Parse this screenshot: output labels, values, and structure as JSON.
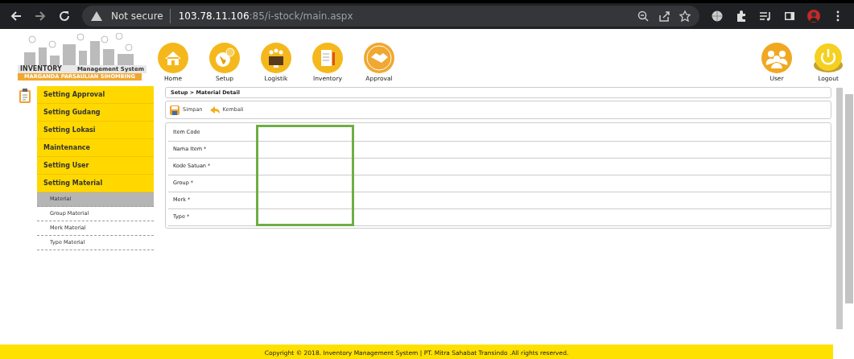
{
  "browser": {
    "security": "Not secure",
    "url_host": "103.78.11.106",
    "url_rest": ":85/i-stock/main.aspx"
  },
  "logo": {
    "title": "INVENTORY",
    "subtitle": "Management System",
    "owner": "MARGANDA PARSAULIAN SIHOMBING"
  },
  "nav": [
    {
      "label": "Home",
      "kind": "home"
    },
    {
      "label": "Setup",
      "kind": "setup"
    },
    {
      "label": "Logistik",
      "kind": "logistik"
    },
    {
      "label": "Inventory",
      "kind": "inventory"
    },
    {
      "label": "Approval",
      "kind": "approval"
    }
  ],
  "nav_right": [
    {
      "label": "User",
      "kind": "user"
    },
    {
      "label": "Logout",
      "kind": "logout"
    }
  ],
  "sidebar": {
    "items": [
      {
        "label": "Setting Approval"
      },
      {
        "label": "Setting Gudang"
      },
      {
        "label": "Setting Lokasi"
      },
      {
        "label": "Maintenance"
      },
      {
        "label": "Setting User"
      },
      {
        "label": "Setting Material",
        "children": [
          {
            "label": "Material",
            "selected": true
          },
          {
            "label": "Group Material",
            "selected": false
          },
          {
            "label": "Merk Material",
            "selected": false
          },
          {
            "label": "Type Material",
            "selected": false
          }
        ]
      }
    ]
  },
  "breadcrumb": "Setup > Material Detail",
  "toolbar": [
    {
      "label": "Simpan",
      "kind": "save"
    },
    {
      "label": "Kembali",
      "kind": "back"
    }
  ],
  "form": {
    "fields": [
      {
        "label": "Item Code"
      },
      {
        "label": "Nama Item *"
      },
      {
        "label": "Kode Satuan *"
      },
      {
        "label": "Group *"
      },
      {
        "label": "Merk *"
      },
      {
        "label": "Type *"
      }
    ]
  },
  "footer": "Copyright © 2018. Inventory Management System | PT. Mitra Sahabat Transindo .All rights reserved."
}
